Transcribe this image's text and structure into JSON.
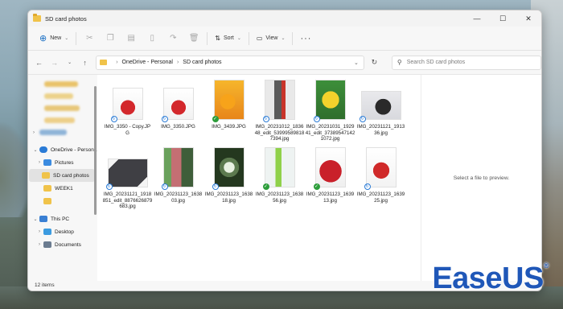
{
  "window": {
    "title": "SD card photos"
  },
  "toolbar": {
    "new_label": "New",
    "sort_label": "Sort",
    "view_label": "View"
  },
  "address": {
    "crumbs": [
      "OneDrive - Personal",
      "SD card photos"
    ],
    "search_placeholder": "Search SD card photos"
  },
  "sidebar": {
    "items": [
      {
        "label": "OneDrive - Persona",
        "icon": "cloud-icon",
        "color": "#2a7bd6"
      },
      {
        "label": "Pictures",
        "icon": "pictures-folder-icon",
        "color": "#3b8be0"
      },
      {
        "label": "SD card photos",
        "icon": "folder-icon",
        "color": "#f0c34a"
      },
      {
        "label": "WEEK1",
        "icon": "folder-icon",
        "color": "#f0c34a"
      },
      {
        "label": "This PC",
        "icon": "computer-icon",
        "color": "#3a7fd3"
      },
      {
        "label": "Desktop",
        "icon": "desktop-icon",
        "color": "#3b9be0"
      },
      {
        "label": "Documents",
        "icon": "documents-icon",
        "color": "#6b7c90"
      }
    ]
  },
  "files": [
    {
      "name": "IMG_3350 - Copy.JPG",
      "status": "sync"
    },
    {
      "name": "IMG_3350.JPG",
      "status": "sync"
    },
    {
      "name": "IMG_3439.JPG",
      "status": "ok"
    },
    {
      "name": "IMG_20231012_183648_edit_539995898187394.jpg",
      "status": "sync"
    },
    {
      "name": "IMG_20231031_192941_edit_373895471421072.jpg",
      "status": "sync"
    },
    {
      "name": "IMG_20231121_191336.jpg",
      "status": "sync"
    },
    {
      "name": "IMG_20231121_1918851_edit_8876626879683.jpg",
      "status": "sync"
    },
    {
      "name": "IMG_20231123_163803.jpg",
      "status": "sync"
    },
    {
      "name": "IMG_20231123_163818.jpg",
      "status": "sync"
    },
    {
      "name": "IMG_20231123_163856.jpg",
      "status": "ok"
    },
    {
      "name": "IMG_20231123_163913.jpg",
      "status": "ok"
    },
    {
      "name": "IMG_20231123_163925.jpg",
      "status": "sync"
    }
  ],
  "preview": {
    "text": "Select a file to preview."
  },
  "status_bar": {
    "count": "12 items"
  },
  "branding": {
    "logo_text": "EaseUS",
    "logo_mark": "®"
  }
}
